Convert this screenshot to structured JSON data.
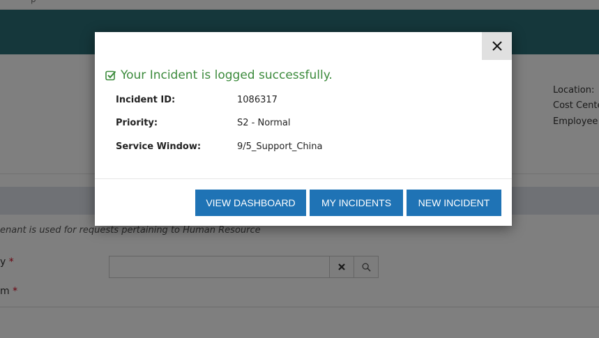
{
  "topbar": {
    "partial_text": "p"
  },
  "info_panel": {
    "labels": [
      "Location:",
      "Cost Cente",
      "Employee T"
    ]
  },
  "form": {
    "tenant_note": "enant is used for requests pertaining to Human Resource",
    "field1_label": "y",
    "field2_label": "m",
    "required_mark": "*",
    "lookup_value": ""
  },
  "modal": {
    "success_message": "Your Incident is logged successfully.",
    "details": [
      {
        "label": "Incident ID:",
        "value": "1086317"
      },
      {
        "label": "Priority:",
        "value": "S2 - Normal"
      },
      {
        "label": "Service Window:",
        "value": "9/5_Support_China"
      }
    ],
    "buttons": {
      "view_dashboard": "VIEW DASHBOARD",
      "my_incidents": "MY INCIDENTS",
      "new_incident": "NEW INCIDENT"
    }
  },
  "colors": {
    "header_teal": "#2b6f77",
    "success_green": "#3b8a3b",
    "button_blue": "#1f73b5",
    "required_red": "#d0021b"
  },
  "icons": {
    "close": "close-icon",
    "success": "check-square-icon",
    "clear": "clear-x-icon",
    "search": "search-icon"
  }
}
